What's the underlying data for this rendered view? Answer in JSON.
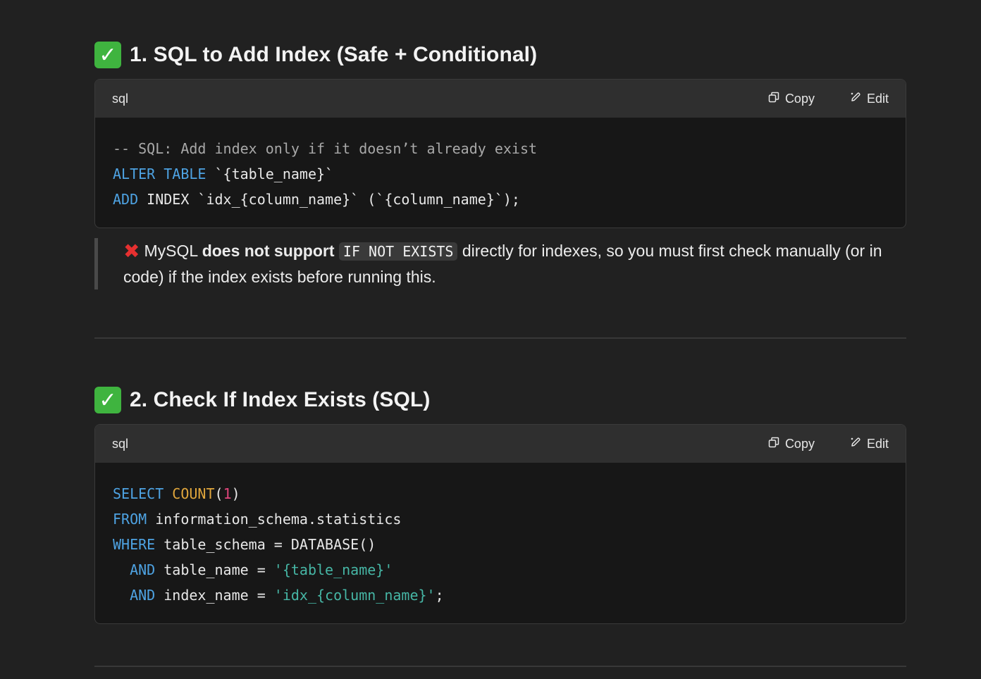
{
  "sections": [
    {
      "check_icon": "✓",
      "title": "1. SQL to Add Index (Safe + Conditional)",
      "code": {
        "language": "sql",
        "copy_label": "Copy",
        "edit_label": "Edit",
        "line1_comment": "-- SQL: Add index only if it doesn’t already exist",
        "line2_kw": "ALTER TABLE",
        "line2_rest": " `{table_name}`",
        "line3_kw": "ADD",
        "line3_rest": " INDEX `idx_{column_name}` (`{column_name}`);"
      },
      "note": {
        "x_icon": "✖",
        "text_before": "MySQL ",
        "bold": "does not support",
        "inline_code": "IF NOT EXISTS",
        "text_after": " directly for indexes, so you must first check manually (or in code) if the index exists before running this."
      }
    },
    {
      "check_icon": "✓",
      "title": "2. Check If Index Exists (SQL)",
      "code": {
        "language": "sql",
        "copy_label": "Copy",
        "edit_label": "Edit",
        "l1_kw": "SELECT",
        "l1_fn": "COUNT",
        "l1_open": "(",
        "l1_num": "1",
        "l1_close": ")",
        "l2_kw": "FROM",
        "l2_rest": " information_schema.statistics",
        "l3_kw": "WHERE",
        "l3_rest": " table_schema = DATABASE()",
        "l4_kw": "AND",
        "l4_mid": " table_name = ",
        "l4_str": "'{table_name}'",
        "l5_kw": "AND",
        "l5_mid": " index_name = ",
        "l5_str": "'idx_{column_name}'",
        "l5_end": ";"
      }
    }
  ],
  "icons": {
    "copy": "copy-icon",
    "edit": "edit-icon",
    "check": "check-mark-icon",
    "cross": "cross-mark-icon"
  },
  "colors": {
    "background": "#212121",
    "code_header": "#2f2f2f",
    "code_body": "#171717",
    "keyword": "#4ea3e3",
    "function": "#e0a63c",
    "number": "#e0457b",
    "string": "#46b6a5",
    "comment": "#a8a8a8",
    "check_green": "#3fb43f",
    "cross_red": "#e63030"
  }
}
